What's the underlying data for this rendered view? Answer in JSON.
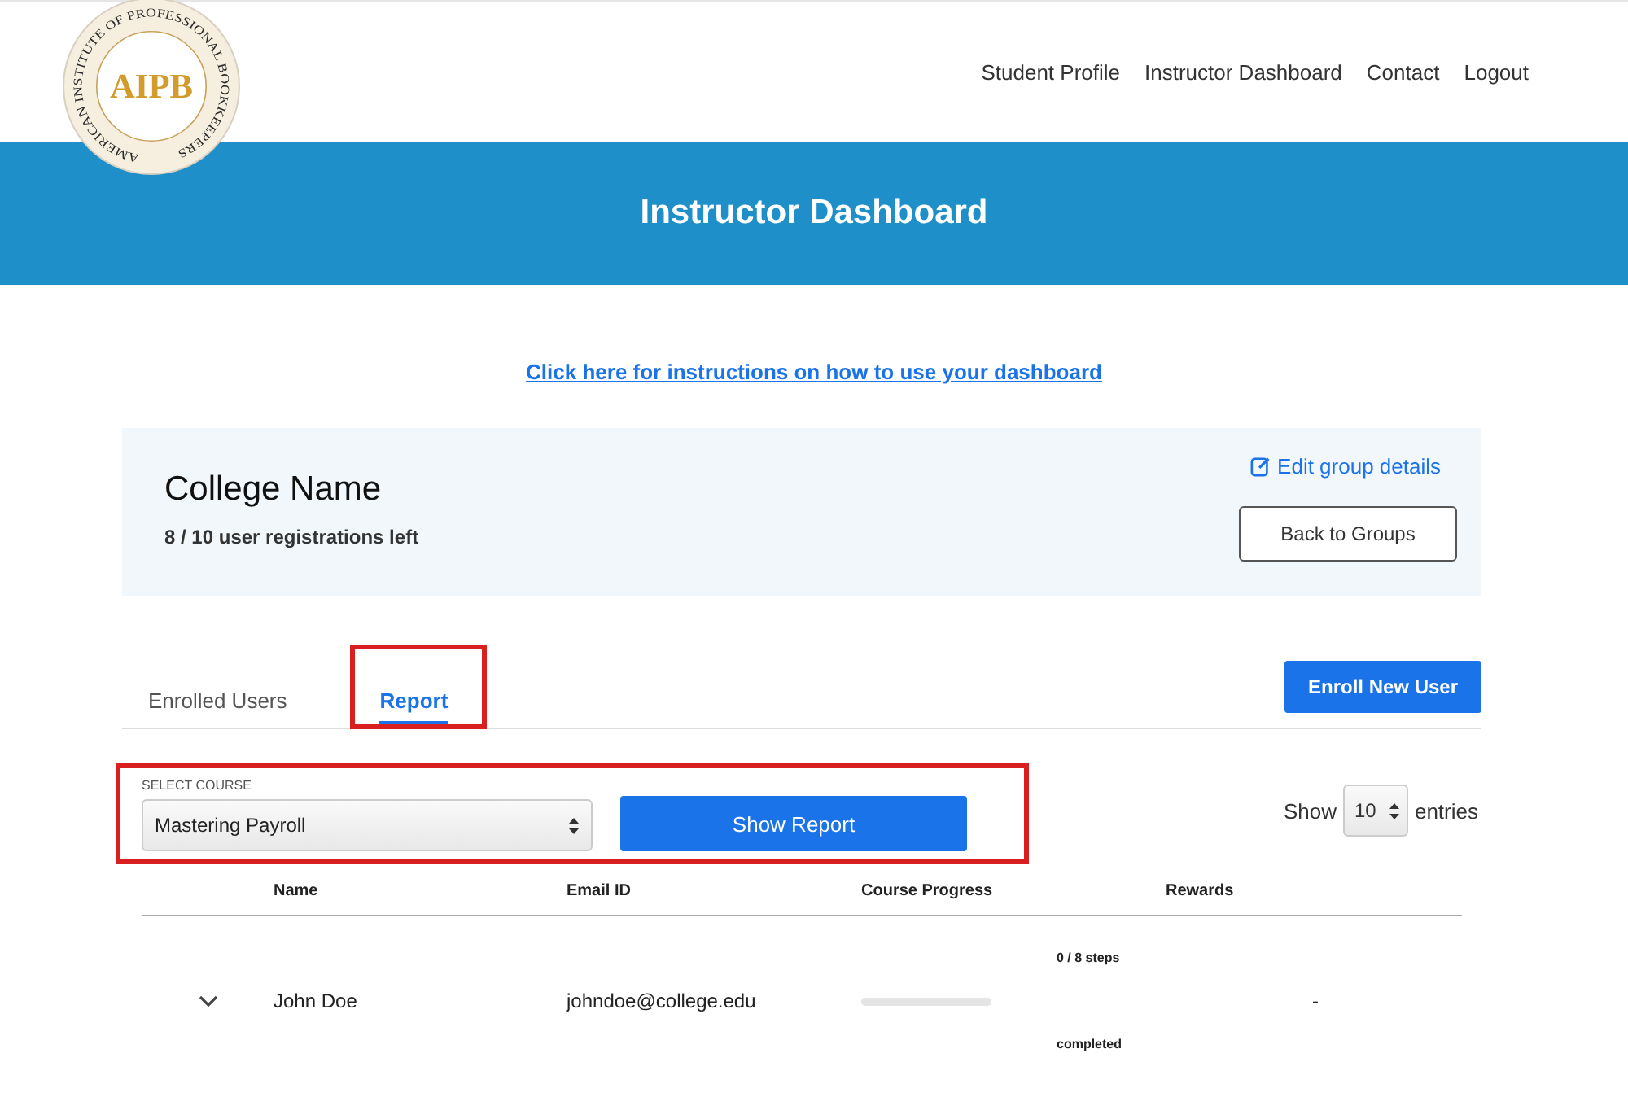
{
  "logo": {
    "initials": "AIPB",
    "ring_text": "AMERICAN INSTITUTE OF PROFESSIONAL BOOKKEEPERS"
  },
  "nav": [
    "Student Profile",
    "Instructor Dashboard",
    "Contact",
    "Logout"
  ],
  "banner": {
    "title": "Instructor Dashboard"
  },
  "instructions_link": "Click here for instructions on how to use your dashboard",
  "group": {
    "name": "College Name",
    "registrations": "8 / 10 user registrations left",
    "edit_link": "Edit group details",
    "back_button": "Back to Groups"
  },
  "tabs": [
    {
      "label": "Enrolled Users",
      "selected": false,
      "highlighted": false
    },
    {
      "label": "Report",
      "selected": true,
      "highlighted": true
    }
  ],
  "enroll_button": "Enroll New User",
  "report_controls": {
    "highlighted": true,
    "select_label": "SELECT COURSE",
    "course": "Mastering Payroll",
    "show_button": "Show Report"
  },
  "page_size": {
    "prefix": "Show",
    "value": "10",
    "suffix": "entries"
  },
  "table": {
    "columns": [
      "Name",
      "Email ID",
      "Course Progress",
      "Rewards"
    ],
    "rows": [
      {
        "expanded": false,
        "name": "John Doe",
        "email": "johndoe@college.edu",
        "level": 0,
        "steps": "0 / 8 steps",
        "status": "completed",
        "rewards": "-"
      }
    ]
  }
}
